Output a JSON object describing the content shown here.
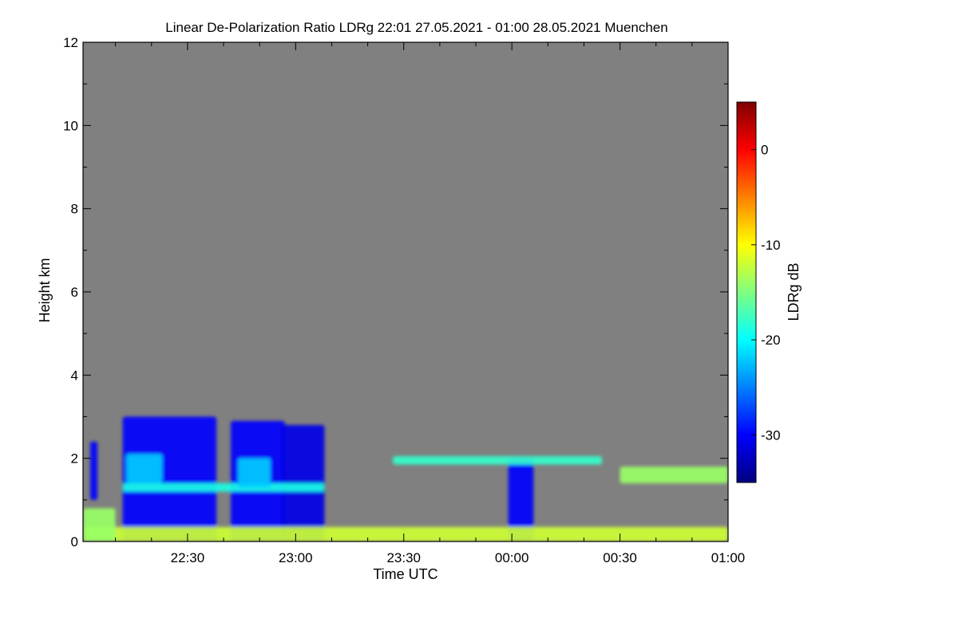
{
  "chart_data": {
    "type": "heatmap",
    "title": "Linear De-Polarization Ratio LDRg   22:01 27.05.2021 - 01:00 28.05.2021 Muenchen",
    "xlabel": "Time UTC",
    "ylabel": "Height km",
    "colorbar_label": "LDRg dB",
    "x_range": [
      "22:01",
      "01:00"
    ],
    "x_ticks": [
      "22:30",
      "23:00",
      "23:30",
      "00:00",
      "00:30",
      "01:00"
    ],
    "y_range": [
      0,
      12
    ],
    "y_ticks": [
      "0",
      "2",
      "4",
      "6",
      "8",
      "10",
      "12"
    ],
    "colorbar_range": [
      -35,
      5
    ],
    "colorbar_ticks": [
      "-30",
      "-20",
      "-10",
      "0"
    ],
    "colors": {
      "background": "#808080",
      "scale": [
        "#000080",
        "#0000ff",
        "#0080ff",
        "#00ffff",
        "#80ff80",
        "#ffff00",
        "#ff8000",
        "#ff0000",
        "#800000"
      ]
    },
    "regions": [
      {
        "start": "22:12",
        "end": "22:38",
        "bottom_km": 0.0,
        "top_km": 3.0,
        "ldr_db": -30
      },
      {
        "start": "22:42",
        "end": "22:57",
        "bottom_km": 0.0,
        "top_km": 2.9,
        "ldr_db": -30
      },
      {
        "start": "22:56",
        "end": "23:08",
        "bottom_km": 0.0,
        "top_km": 2.8,
        "ldr_db": -31
      },
      {
        "start": "22:03",
        "end": "22:05",
        "bottom_km": 1.0,
        "top_km": 2.4,
        "ldr_db": -30
      },
      {
        "start": "23:59",
        "end": "00:06",
        "bottom_km": 0.0,
        "top_km": 2.0,
        "ldr_db": -30
      },
      {
        "start": "22:12",
        "end": "23:08",
        "bottom_km": 1.2,
        "top_km": 1.4,
        "ldr_db": -19
      },
      {
        "start": "22:13",
        "end": "22:23",
        "bottom_km": 1.4,
        "top_km": 2.1,
        "ldr_db": -22
      },
      {
        "start": "22:44",
        "end": "22:53",
        "bottom_km": 1.3,
        "top_km": 2.0,
        "ldr_db": -22
      },
      {
        "start": "23:27",
        "end": "00:25",
        "bottom_km": 1.85,
        "top_km": 2.05,
        "ldr_db": -18
      },
      {
        "start": "00:30",
        "end": "01:00",
        "bottom_km": 1.4,
        "top_km": 1.8,
        "ldr_db": -14
      },
      {
        "start": "22:01",
        "end": "01:00",
        "bottom_km": 0.0,
        "top_km": 0.35,
        "ldr_db": -12
      },
      {
        "start": "22:01",
        "end": "22:10",
        "bottom_km": 0.0,
        "top_km": 0.8,
        "ldr_db": -14
      }
    ]
  }
}
